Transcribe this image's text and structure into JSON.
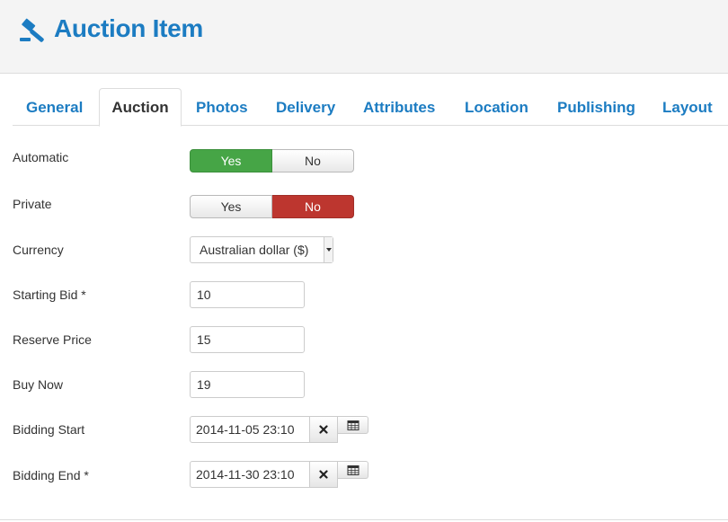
{
  "header": {
    "title": "Auction Item",
    "icon": "gavel-icon"
  },
  "tabs": [
    {
      "label": "General",
      "active": false
    },
    {
      "label": "Auction",
      "active": true
    },
    {
      "label": "Photos",
      "active": false
    },
    {
      "label": "Delivery",
      "active": false
    },
    {
      "label": "Attributes",
      "active": false
    },
    {
      "label": "Location",
      "active": false
    },
    {
      "label": "Publishing",
      "active": false
    },
    {
      "label": "Layout",
      "active": false
    }
  ],
  "form": {
    "automatic": {
      "label": "Automatic",
      "yes": "Yes",
      "no": "No",
      "selected": "Yes"
    },
    "private": {
      "label": "Private",
      "yes": "Yes",
      "no": "No",
      "selected": "No"
    },
    "currency": {
      "label": "Currency",
      "value": "Australian dollar ($)"
    },
    "starting_bid": {
      "label": "Starting Bid *",
      "value": "10"
    },
    "reserve_price": {
      "label": "Reserve Price",
      "value": "15"
    },
    "buy_now": {
      "label": "Buy Now",
      "value": "19"
    },
    "bidding_start": {
      "label": "Bidding Start",
      "value": "2014-11-05 23:10"
    },
    "bidding_end": {
      "label": "Bidding End *",
      "value": "2014-11-30 23:10"
    }
  },
  "colors": {
    "accent": "#1c7cc2",
    "yes_active": "#46a546",
    "no_active": "#bd362f"
  }
}
